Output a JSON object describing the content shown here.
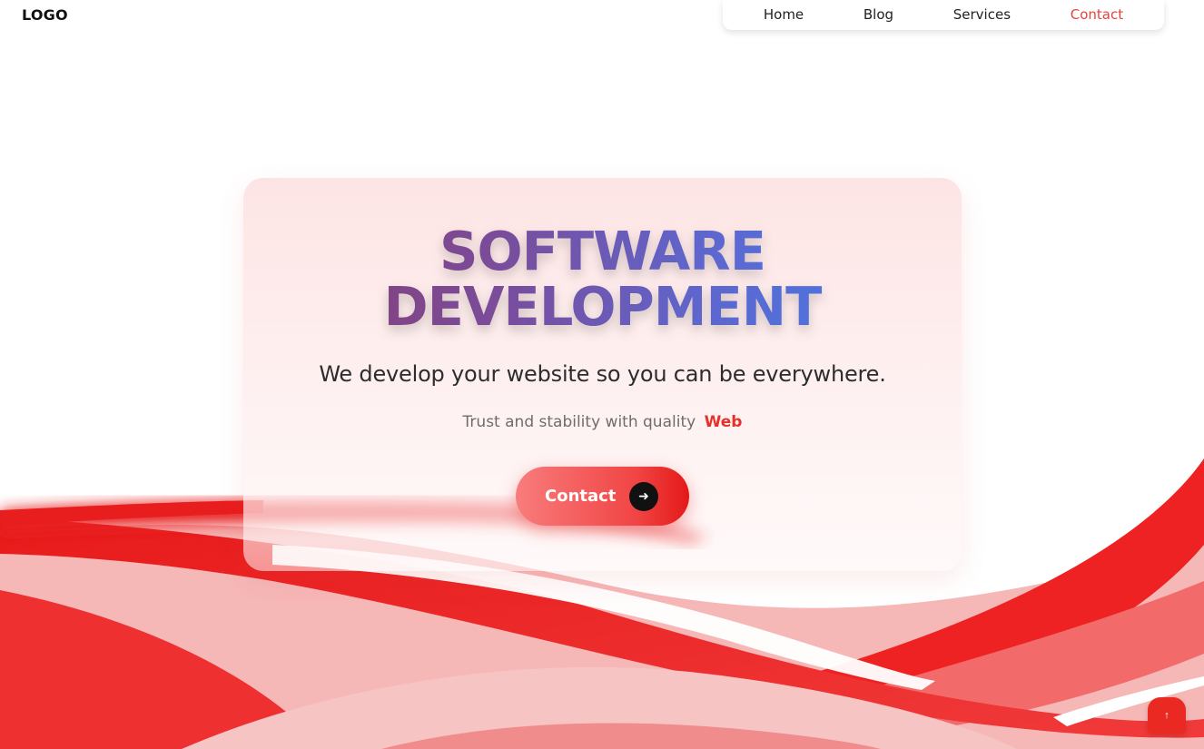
{
  "header": {
    "logo": "LOGO",
    "nav": [
      {
        "label": "Home"
      },
      {
        "label": "Blog"
      },
      {
        "label": "Services"
      },
      {
        "label": "Contact"
      }
    ],
    "active_nav": "Contact"
  },
  "hero": {
    "title_line1": "SOFTWARE",
    "title_line2": "DEVELOPMENT",
    "subtitle": "We develop your website so you can be everywhere.",
    "tagline": "Trust and stability with quality",
    "tagline_accent": "Web",
    "cta_label": "Contact",
    "cta_icon": "arrow-right-icon"
  },
  "scroll_top_icon": "arrow-up-icon",
  "colors": {
    "accent": "#e8302a",
    "title_gradient_start": "#8a3b6b",
    "title_gradient_end": "#3f7fe8",
    "wave_red": "#ec1c1c"
  }
}
